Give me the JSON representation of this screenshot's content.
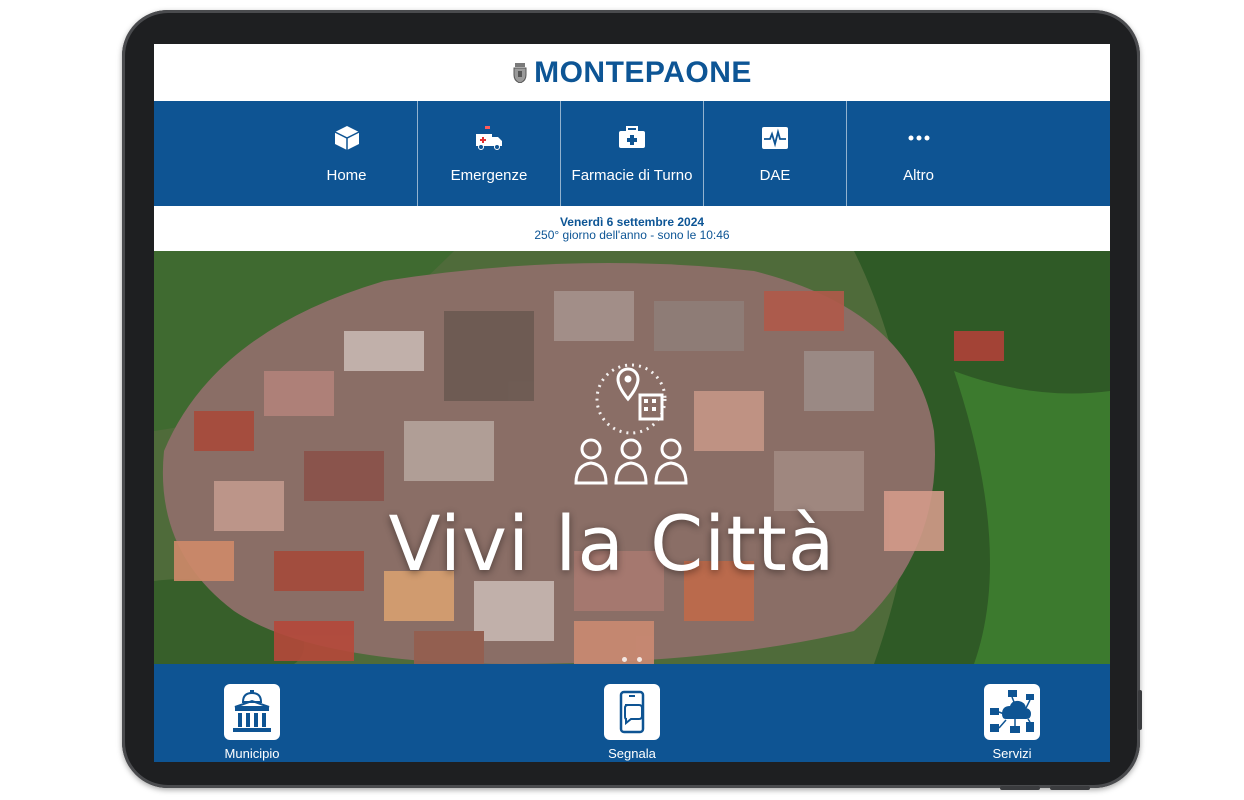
{
  "app": {
    "title": "MONTEPAONE"
  },
  "nav": {
    "items": [
      {
        "label": "Home",
        "icon": "cube-icon"
      },
      {
        "label": "Emergenze",
        "icon": "ambulance-icon"
      },
      {
        "label": "Farmacie di Turno",
        "icon": "first-aid-kit-icon"
      },
      {
        "label": "DAE",
        "icon": "heartbeat-monitor-icon"
      },
      {
        "label": "Altro",
        "icon": "more-dots-icon"
      }
    ]
  },
  "datebar": {
    "date": "Venerdì 6 settembre 2024",
    "info": "250° giorno dell'anno - sono le 10:46"
  },
  "hero": {
    "title": "Vivi la Città",
    "icon": "city-people-icon",
    "slide_count": 2
  },
  "bottom": {
    "items": [
      {
        "label": "Municipio",
        "icon": "town-hall-icon"
      },
      {
        "label": "Segnala",
        "icon": "phone-chat-icon"
      },
      {
        "label": "Servizi",
        "icon": "network-services-icon"
      }
    ]
  },
  "colors": {
    "brand_blue": "#0e5493",
    "title_blue": "#0d5595"
  }
}
